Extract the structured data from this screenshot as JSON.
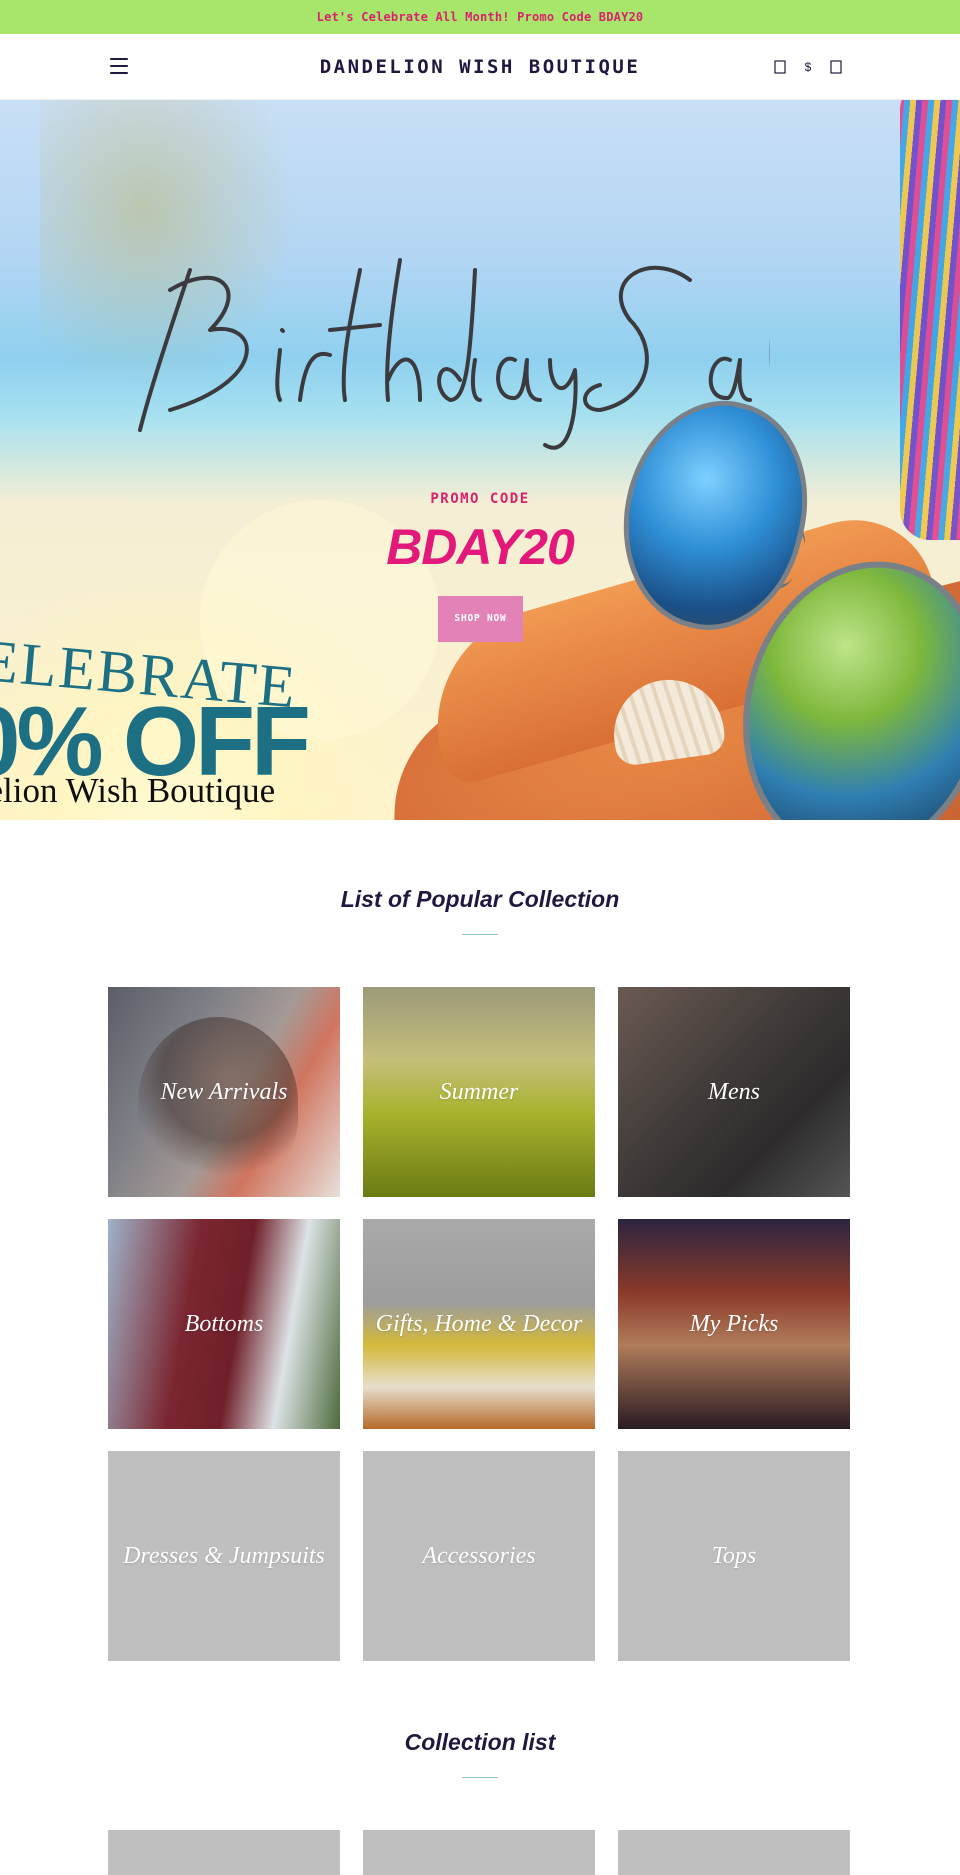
{
  "announcement": {
    "text": "Let's Celebrate All Month! Promo Code BDAY20"
  },
  "header": {
    "logo": "DANDELION WISH BOUTIQUE",
    "icons": {
      "search": "search-icon",
      "currency": "$",
      "cart": "cart-icon",
      "menu": "hamburger-menu-icon"
    }
  },
  "hero": {
    "script_title": "Birthday Sale",
    "promo_label": "PROMO CODE",
    "promo_code": "BDAY20",
    "shop_button": "SHOP NOW",
    "celebrate": "ELEBRATE",
    "discount": "0% OFF",
    "shop_name": "delion Wish Boutique"
  },
  "popular": {
    "title": "List of Popular Collection",
    "items": [
      {
        "label": "New Arrivals"
      },
      {
        "label": "Summer"
      },
      {
        "label": "Mens"
      },
      {
        "label": "Bottoms"
      },
      {
        "label": "Gifts, Home & Decor"
      },
      {
        "label": "My Picks"
      },
      {
        "label": "Dresses & Jumpsuits"
      },
      {
        "label": "Accessories"
      },
      {
        "label": "Tops"
      }
    ]
  },
  "collection_list": {
    "title": "Collection list"
  }
}
